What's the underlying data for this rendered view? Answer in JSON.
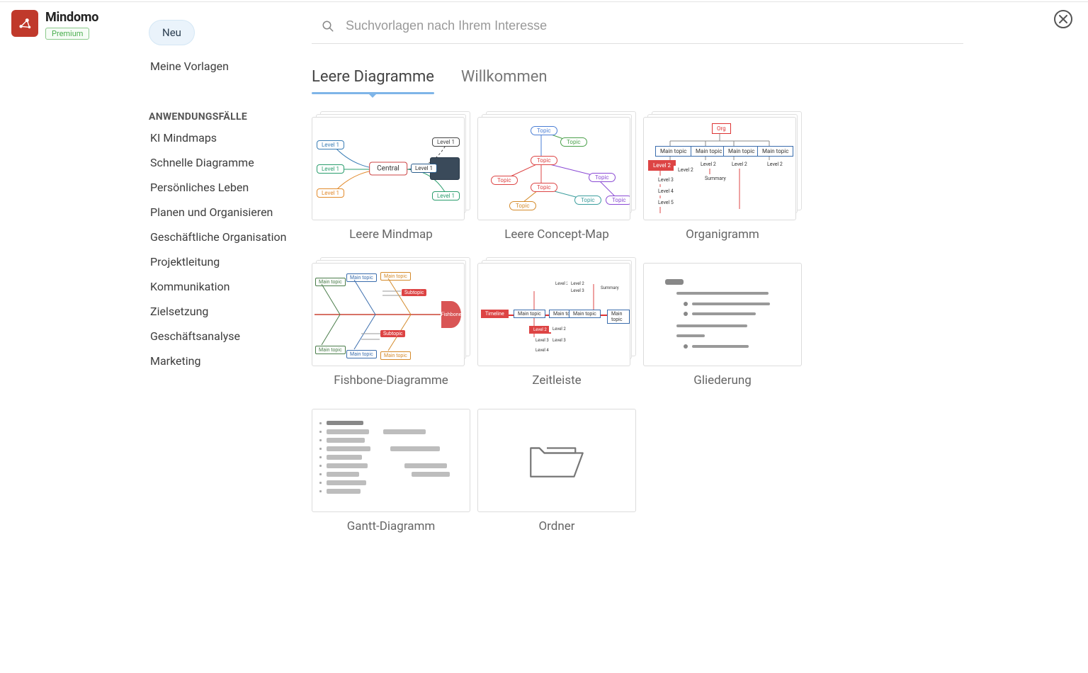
{
  "brand": {
    "name": "Mindomo",
    "badge": "Premium"
  },
  "search": {
    "placeholder": "Suchvorlagen nach Ihrem Interesse"
  },
  "sidebar": {
    "new_label": "Neu",
    "my_templates": "Meine Vorlagen",
    "section_header": "ANWENDUNGSFÄLLE",
    "items": [
      "KI Mindmaps",
      "Schnelle Diagramme",
      "Persönliches Leben",
      "Planen und Organisieren",
      "Geschäftliche Organisation",
      "Projektleitung",
      "Kommunikation",
      "Zielsetzung",
      "Geschäftsanalyse",
      "Marketing"
    ]
  },
  "tabs": {
    "empty": "Leere Diagramme",
    "welcome": "Willkommen"
  },
  "cards": {
    "mindmap": "Leere Mindmap",
    "concept": "Leere Concept-Map",
    "org": "Organigramm",
    "fishbone": "Fishbone-Diagramme",
    "timeline": "Zeitleiste",
    "outline": "Gliederung",
    "gantt": "Gantt-Diagramm",
    "folder": "Ordner"
  },
  "thumb_labels": {
    "central": "Central",
    "level1": "Level 1",
    "topic": "Topic",
    "org": "Org",
    "main_topic": "Main topic",
    "level2": "Level 2",
    "level3": "Level 3",
    "level4": "Level 4",
    "level5": "Level 5",
    "summary": "Summary",
    "fishbone": "Fishbone",
    "timeline": "Timeline",
    "subtopic": "Subtopic"
  }
}
